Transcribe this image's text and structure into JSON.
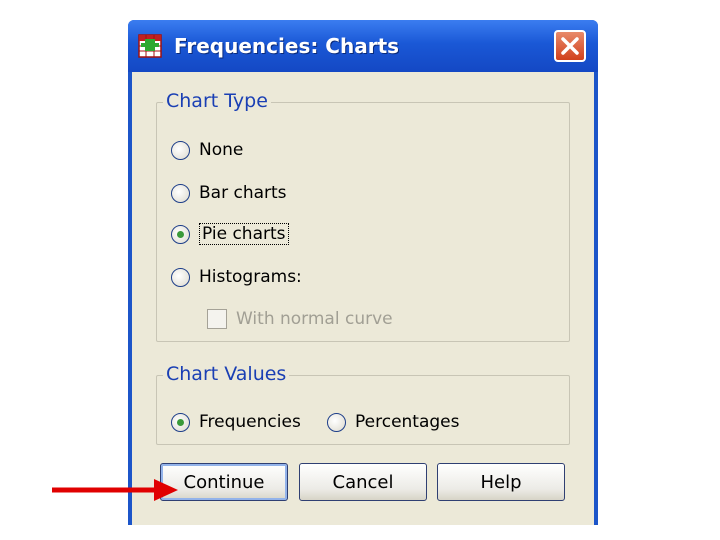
{
  "window": {
    "title": "Frequencies: Charts"
  },
  "chart_type": {
    "legend": "Chart Type",
    "options": [
      "None",
      "Bar charts",
      "Pie charts",
      "Histograms:"
    ],
    "selected": "Pie charts",
    "with_normal_curve": "With normal curve"
  },
  "chart_values": {
    "legend": "Chart Values",
    "options": [
      "Frequencies",
      "Percentages"
    ],
    "selected": "Frequencies"
  },
  "buttons": {
    "continue": "Continue",
    "cancel": "Cancel",
    "help": "Help"
  },
  "colors": {
    "title_bar": "#1a58d6",
    "client_bg": "#ece9d8",
    "legend_text": "#1a3fb4",
    "arrow": "#e00000"
  },
  "icons": {
    "app": "spss-table-icon",
    "close": "close-icon",
    "pointer": "red-arrow-icon"
  }
}
